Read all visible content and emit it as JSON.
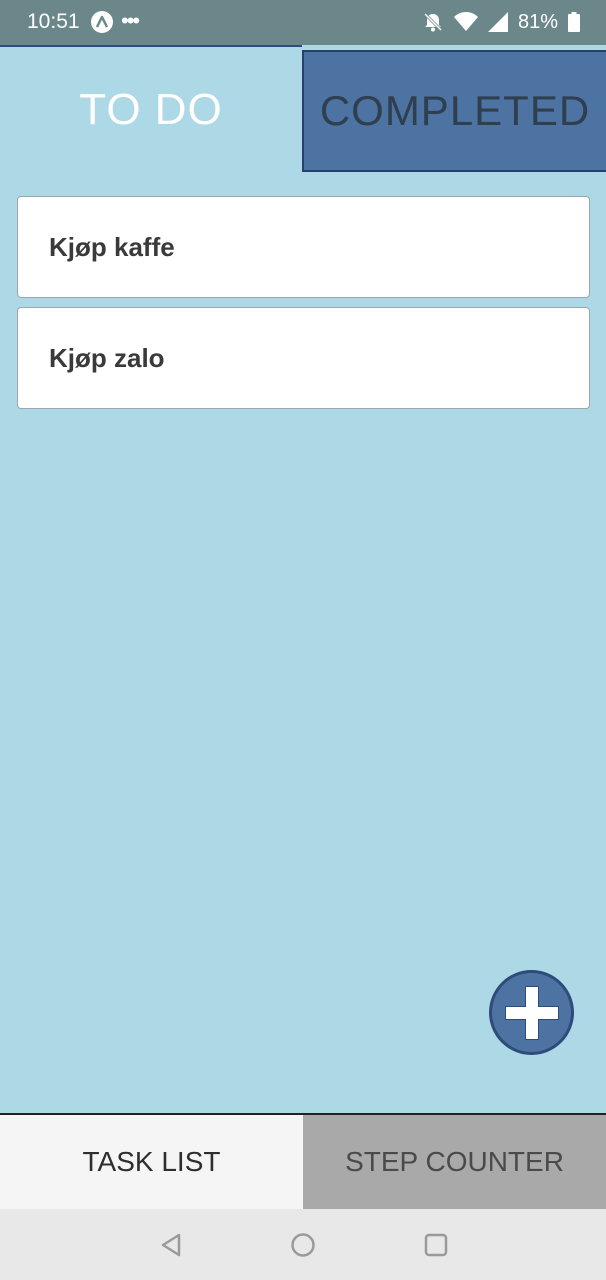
{
  "status_bar": {
    "time": "10:51",
    "more_indicator": "•••",
    "battery_percent": "81%",
    "icons": [
      "app-icon",
      "bell-off-icon",
      "wifi-icon",
      "signal-icon",
      "battery-icon"
    ]
  },
  "top_tabs": [
    {
      "label": "TO DO",
      "selected": true
    },
    {
      "label": "COMPLETED",
      "selected": false
    }
  ],
  "tasks": [
    {
      "label": "Kjøp kaffe"
    },
    {
      "label": "Kjøp zalo"
    }
  ],
  "fab": {
    "icon": "plus-icon"
  },
  "bottom_nav": [
    {
      "label": "TASK LIST",
      "selected": true
    },
    {
      "label": "STEP COUNTER",
      "selected": false
    }
  ],
  "system_nav": {
    "icons": [
      "back-icon",
      "home-icon",
      "recents-icon"
    ]
  },
  "colors": {
    "background": "#add8e6",
    "accent": "#4d73a3",
    "status_bar": "#6b8789",
    "bottom_nav_inactive": "#a9a9a9"
  }
}
